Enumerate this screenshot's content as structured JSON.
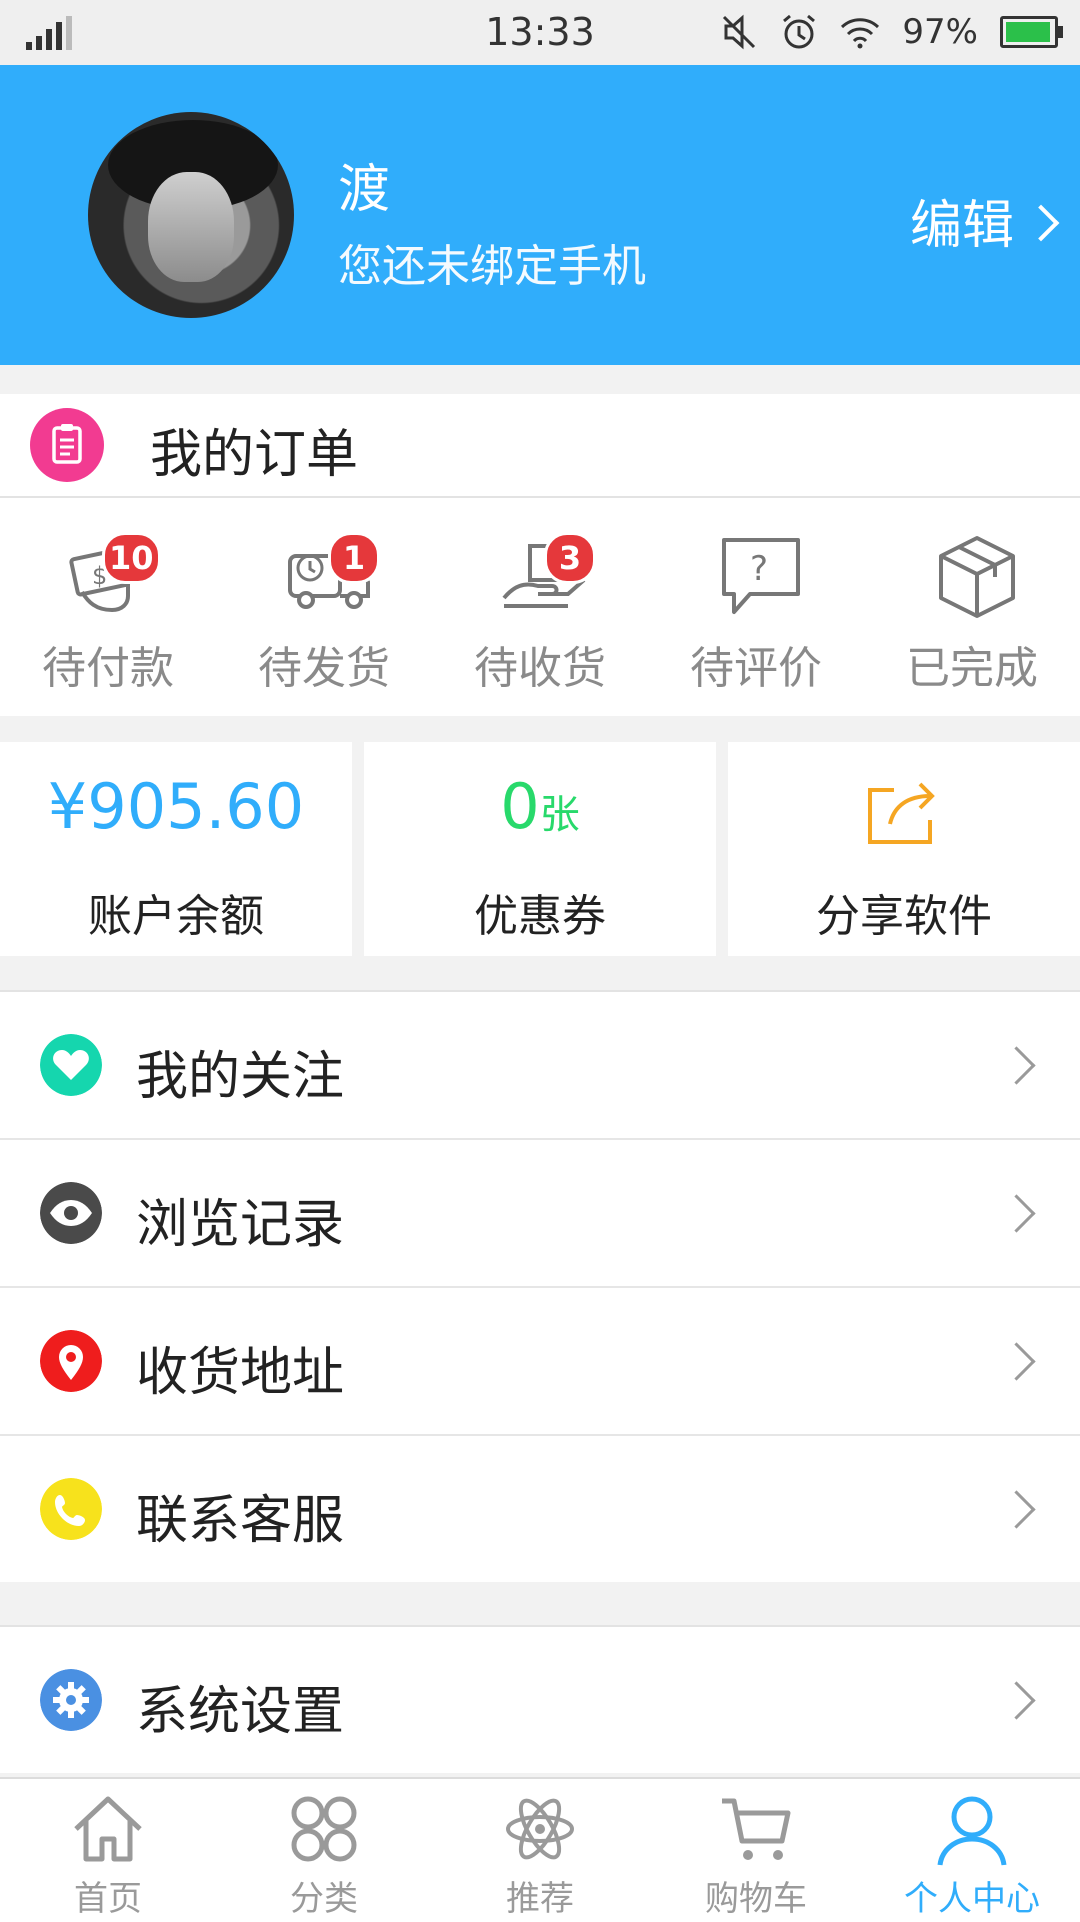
{
  "status_bar": {
    "time": "13:33",
    "battery": "97%"
  },
  "profile": {
    "name": "渡",
    "phone_note": "您还未绑定手机",
    "edit_label": "编辑"
  },
  "orders": {
    "title": "我的订单",
    "items": [
      {
        "label": "待付款",
        "badge": "10",
        "icon": "payment-icon"
      },
      {
        "label": "待发货",
        "badge": "1",
        "icon": "delivery-truck-icon"
      },
      {
        "label": "待收货",
        "badge": "3",
        "icon": "receive-package-icon"
      },
      {
        "label": "待评价",
        "badge": "",
        "icon": "review-icon"
      },
      {
        "label": "已完成",
        "badge": "",
        "icon": "completed-box-icon"
      }
    ]
  },
  "stats": {
    "balance": {
      "value": "¥905.60",
      "label": "账户余额"
    },
    "coupons": {
      "value": "0",
      "unit": "张",
      "label": "优惠券"
    },
    "share": {
      "label": "分享软件"
    }
  },
  "menu": {
    "group1": [
      {
        "label": "我的关注",
        "icon": "heart-icon",
        "color": "#15d6ae"
      },
      {
        "label": "浏览记录",
        "icon": "eye-icon",
        "color": "#4a4a4a"
      },
      {
        "label": "收货地址",
        "icon": "location-pin-icon",
        "color": "#ef1d1d"
      },
      {
        "label": "联系客服",
        "icon": "phone-icon",
        "color": "#f7e21c"
      }
    ],
    "group2": [
      {
        "label": "系统设置",
        "icon": "gear-icon",
        "color": "#4a90e2"
      }
    ]
  },
  "tabbar": [
    {
      "label": "首页",
      "icon": "home-icon"
    },
    {
      "label": "分类",
      "icon": "category-icon"
    },
    {
      "label": "推荐",
      "icon": "recommend-icon"
    },
    {
      "label": "购物车",
      "icon": "cart-icon"
    },
    {
      "label": "个人中心",
      "icon": "user-icon",
      "active": true
    }
  ],
  "colors": {
    "accent": "#30adfb",
    "badge": "#e5383b",
    "order_icon": "#f23b91"
  }
}
